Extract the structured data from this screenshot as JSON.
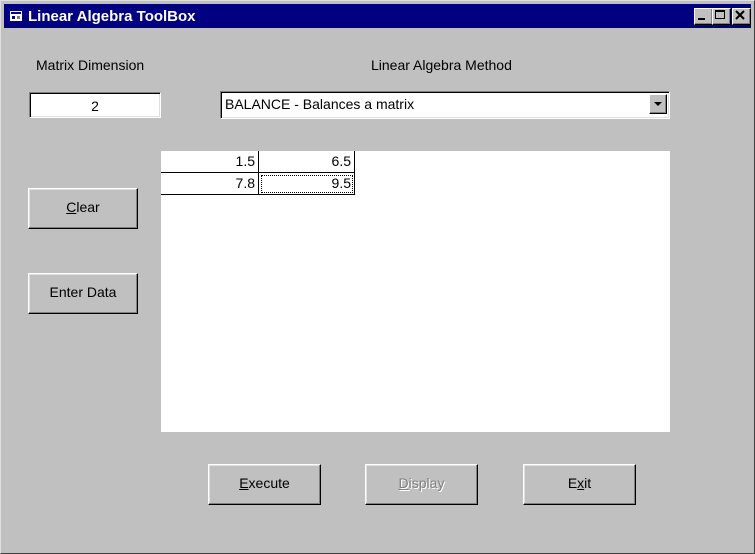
{
  "window": {
    "title": "Linear Algebra ToolBox",
    "minimize_icon": "minimize-icon",
    "maximize_icon": "maximize-icon",
    "close_icon": "close-icon"
  },
  "matrix_dimension": {
    "label": "Matrix Dimension",
    "value": "2"
  },
  "method": {
    "label": "Linear Algebra Method",
    "selected": "BALANCE - Balances a matrix"
  },
  "matrix": {
    "rows": [
      [
        "1.5",
        "6.5"
      ],
      [
        "7.8",
        "9.5"
      ]
    ]
  },
  "buttons": {
    "clear": {
      "mnemonic": "C",
      "rest": "lear"
    },
    "enter_data": "Enter Data",
    "execute": {
      "mnemonic": "E",
      "rest": "xecute"
    },
    "display": {
      "mnemonic": "D",
      "rest": "isplay"
    },
    "exit": {
      "pre": "E",
      "mnemonic": "x",
      "rest": "it"
    }
  },
  "colors": {
    "titlebar": "#000080",
    "face": "#c0c0c0"
  }
}
